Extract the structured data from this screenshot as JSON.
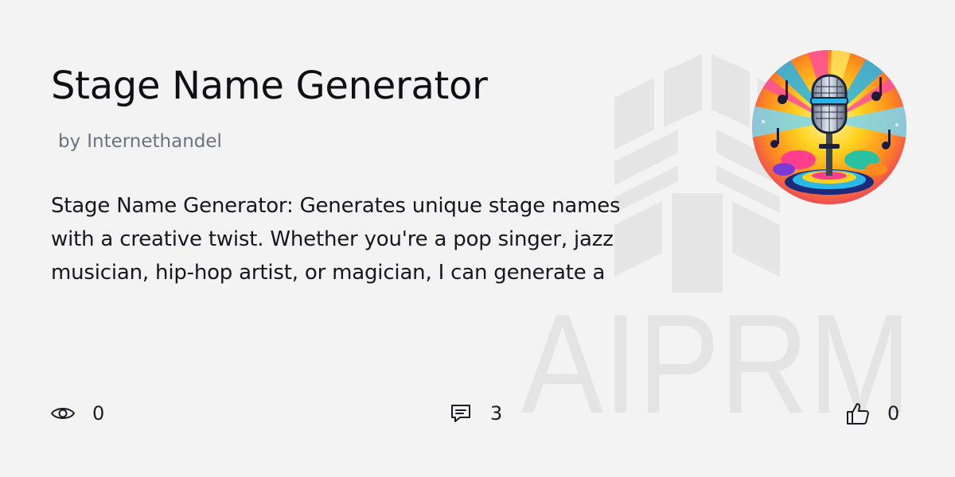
{
  "card": {
    "title": "Stage Name Generator",
    "author_prefix": "by",
    "author": "Internethandel",
    "description_lines": [
      "Stage Name Generator: Generates unique stage names",
      "with a creative twist. Whether you're a pop singer, jazz",
      "musician, hip-hop artist, or magician, I can generate a"
    ]
  },
  "stats": {
    "views": "0",
    "comments": "3",
    "likes": "0"
  },
  "watermark": {
    "text": "AIPRM",
    "color": "#e4e4e4"
  },
  "icons": {
    "views": "eye-icon",
    "comments": "comment-icon",
    "likes": "thumbs-up-icon"
  },
  "avatar": {
    "subject": "microphone-illustration"
  }
}
